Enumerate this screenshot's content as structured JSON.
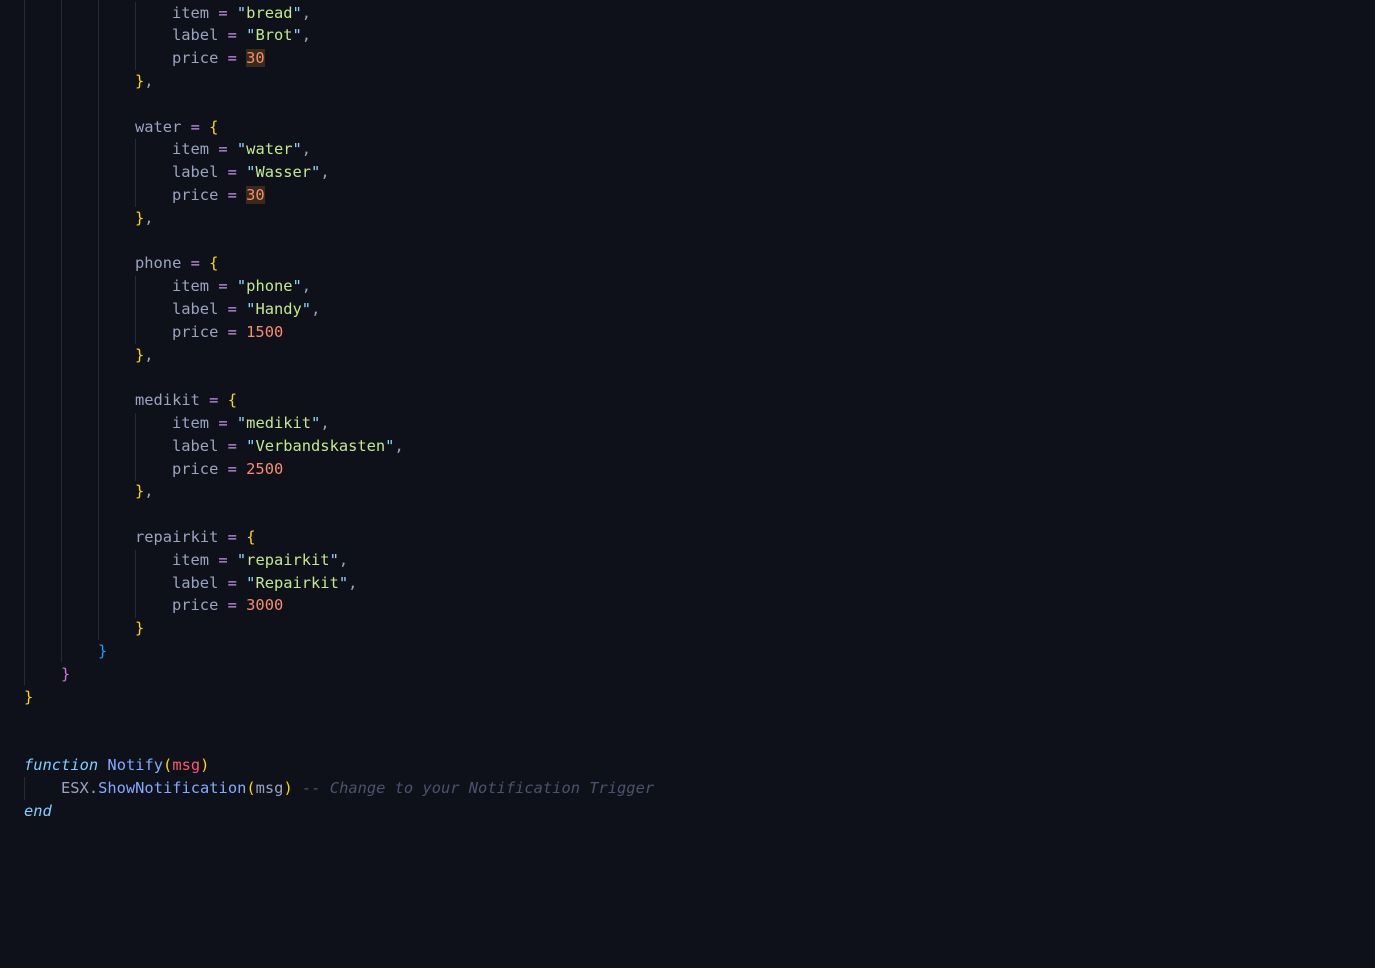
{
  "editor": {
    "language": "lua",
    "colors": {
      "background": "#0e111a",
      "string": "#c3e88d",
      "number": "#f78c6c",
      "keyword": "#7dcfff",
      "function": "#82aaff",
      "comment": "#4b526d"
    },
    "lines": [
      {
        "indent": 4,
        "tokens": [
          [
            "item",
            "k"
          ],
          [
            " = ",
            "op"
          ],
          [
            "\"",
            "q"
          ],
          [
            "bread",
            "s"
          ],
          [
            "\"",
            "q"
          ],
          [
            ",",
            "p"
          ]
        ]
      },
      {
        "indent": 4,
        "tokens": [
          [
            "label",
            "k"
          ],
          [
            " = ",
            "op"
          ],
          [
            "\"",
            "q"
          ],
          [
            "Brot",
            "s"
          ],
          [
            "\"",
            "q"
          ],
          [
            ",",
            "p"
          ]
        ]
      },
      {
        "indent": 4,
        "tokens": [
          [
            "price",
            "k"
          ],
          [
            " = ",
            "op"
          ],
          [
            "30",
            "nh"
          ]
        ]
      },
      {
        "indent": 3,
        "tokens": [
          [
            "}",
            "by"
          ],
          [
            ",",
            "p"
          ]
        ]
      },
      {
        "indent": 0,
        "tokens": []
      },
      {
        "indent": 3,
        "tokens": [
          [
            "water",
            "k"
          ],
          [
            " = ",
            "op"
          ],
          [
            "{",
            "by"
          ]
        ]
      },
      {
        "indent": 4,
        "tokens": [
          [
            "item",
            "k"
          ],
          [
            " = ",
            "op"
          ],
          [
            "\"",
            "q"
          ],
          [
            "water",
            "s"
          ],
          [
            "\"",
            "q"
          ],
          [
            ",",
            "p"
          ]
        ]
      },
      {
        "indent": 4,
        "tokens": [
          [
            "label",
            "k"
          ],
          [
            " = ",
            "op"
          ],
          [
            "\"",
            "q"
          ],
          [
            "Wasser",
            "s"
          ],
          [
            "\"",
            "q"
          ],
          [
            ",",
            "p"
          ]
        ]
      },
      {
        "indent": 4,
        "tokens": [
          [
            "price",
            "k"
          ],
          [
            " = ",
            "op"
          ],
          [
            "30",
            "nh"
          ]
        ]
      },
      {
        "indent": 3,
        "tokens": [
          [
            "}",
            "by"
          ],
          [
            ",",
            "p"
          ]
        ]
      },
      {
        "indent": 0,
        "tokens": []
      },
      {
        "indent": 3,
        "tokens": [
          [
            "phone",
            "k"
          ],
          [
            " = ",
            "op"
          ],
          [
            "{",
            "by"
          ]
        ]
      },
      {
        "indent": 4,
        "tokens": [
          [
            "item",
            "k"
          ],
          [
            " = ",
            "op"
          ],
          [
            "\"",
            "q"
          ],
          [
            "phone",
            "s"
          ],
          [
            "\"",
            "q"
          ],
          [
            ",",
            "p"
          ]
        ]
      },
      {
        "indent": 4,
        "tokens": [
          [
            "label",
            "k"
          ],
          [
            " = ",
            "op"
          ],
          [
            "\"",
            "q"
          ],
          [
            "Handy",
            "s"
          ],
          [
            "\"",
            "q"
          ],
          [
            ",",
            "p"
          ]
        ]
      },
      {
        "indent": 4,
        "tokens": [
          [
            "price",
            "k"
          ],
          [
            " = ",
            "op"
          ],
          [
            "1500",
            "n"
          ]
        ]
      },
      {
        "indent": 3,
        "tokens": [
          [
            "}",
            "by"
          ],
          [
            ",",
            "p"
          ]
        ]
      },
      {
        "indent": 0,
        "tokens": []
      },
      {
        "indent": 3,
        "tokens": [
          [
            "medikit",
            "k"
          ],
          [
            " = ",
            "op"
          ],
          [
            "{",
            "by"
          ]
        ]
      },
      {
        "indent": 4,
        "tokens": [
          [
            "item",
            "k"
          ],
          [
            " = ",
            "op"
          ],
          [
            "\"",
            "q"
          ],
          [
            "medikit",
            "s"
          ],
          [
            "\"",
            "q"
          ],
          [
            ",",
            "p"
          ]
        ]
      },
      {
        "indent": 4,
        "tokens": [
          [
            "label",
            "k"
          ],
          [
            " = ",
            "op"
          ],
          [
            "\"",
            "q"
          ],
          [
            "Verbandskasten",
            "s"
          ],
          [
            "\"",
            "q"
          ],
          [
            ",",
            "p"
          ]
        ]
      },
      {
        "indent": 4,
        "tokens": [
          [
            "price",
            "k"
          ],
          [
            " = ",
            "op"
          ],
          [
            "2500",
            "n"
          ]
        ]
      },
      {
        "indent": 3,
        "tokens": [
          [
            "}",
            "by"
          ],
          [
            ",",
            "p"
          ]
        ]
      },
      {
        "indent": 0,
        "tokens": []
      },
      {
        "indent": 3,
        "tokens": [
          [
            "repairkit",
            "k"
          ],
          [
            " = ",
            "op"
          ],
          [
            "{",
            "by"
          ]
        ]
      },
      {
        "indent": 4,
        "tokens": [
          [
            "item",
            "k"
          ],
          [
            " = ",
            "op"
          ],
          [
            "\"",
            "q"
          ],
          [
            "repairkit",
            "s"
          ],
          [
            "\"",
            "q"
          ],
          [
            ",",
            "p"
          ]
        ]
      },
      {
        "indent": 4,
        "tokens": [
          [
            "label",
            "k"
          ],
          [
            " = ",
            "op"
          ],
          [
            "\"",
            "q"
          ],
          [
            "Repairkit",
            "s"
          ],
          [
            "\"",
            "q"
          ],
          [
            ",",
            "p"
          ]
        ]
      },
      {
        "indent": 4,
        "tokens": [
          [
            "price",
            "k"
          ],
          [
            " = ",
            "op"
          ],
          [
            "3000",
            "n"
          ]
        ]
      },
      {
        "indent": 3,
        "tokens": [
          [
            "}",
            "by"
          ]
        ]
      },
      {
        "indent": 2,
        "tokens": [
          [
            "}",
            "bb"
          ]
        ]
      },
      {
        "indent": 1,
        "tokens": [
          [
            "}",
            "bp"
          ]
        ]
      },
      {
        "indent": 0,
        "tokens": [
          [
            "}",
            "by"
          ]
        ]
      },
      {
        "indent": 0,
        "tokens": []
      },
      {
        "indent": 0,
        "tokens": []
      },
      {
        "indent": 0,
        "tokens": [
          [
            "function",
            "kw"
          ],
          [
            " ",
            "p"
          ],
          [
            "Notify",
            "fn"
          ],
          [
            "(",
            "by"
          ],
          [
            "msg",
            "pm"
          ],
          [
            ")",
            "by"
          ]
        ]
      },
      {
        "indent": 1,
        "tokens": [
          [
            "ESX",
            "id"
          ],
          [
            ".",
            "p"
          ],
          [
            "ShowNotification",
            "fn"
          ],
          [
            "(",
            "by"
          ],
          [
            "msg",
            "id"
          ],
          [
            ")",
            "by"
          ],
          [
            " -- Change to your Notification Trigger",
            "cm"
          ]
        ]
      },
      {
        "indent": 0,
        "tokens": [
          [
            "end",
            "kw"
          ]
        ]
      }
    ]
  }
}
